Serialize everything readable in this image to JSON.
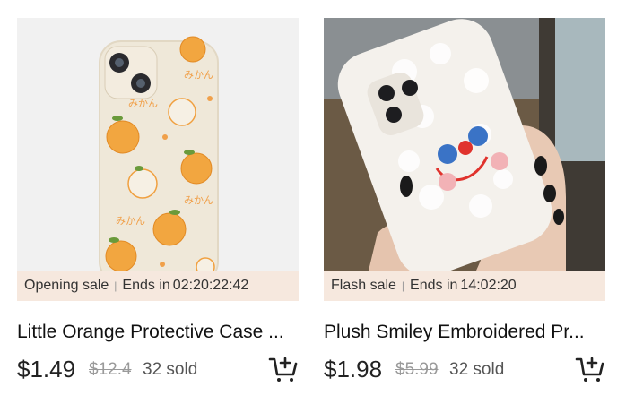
{
  "products": [
    {
      "image_desc": "orange-print-phone-case",
      "promo": {
        "label": "Opening sale",
        "ends_label": "Ends in",
        "countdown": "02:20:22:42"
      },
      "title": "Little Orange Protective Case ...",
      "price": "$1.49",
      "original_price": "$12.4",
      "sold": "32 sold",
      "cart_icon": "add-to-cart-icon"
    },
    {
      "image_desc": "plush-smiley-phone-case",
      "promo": {
        "label": "Flash sale",
        "ends_label": "Ends in",
        "countdown": "14:02:20"
      },
      "title": "Plush Smiley Embroidered Pr...",
      "price": "$1.98",
      "original_price": "$5.99",
      "sold": "32 sold",
      "cart_icon": "add-to-cart-icon"
    }
  ],
  "image_text": {
    "mikan": "みかん"
  },
  "colors": {
    "promo_bg": "#f6e8de",
    "strike": "#9a9a9a",
    "text": "#222222"
  }
}
